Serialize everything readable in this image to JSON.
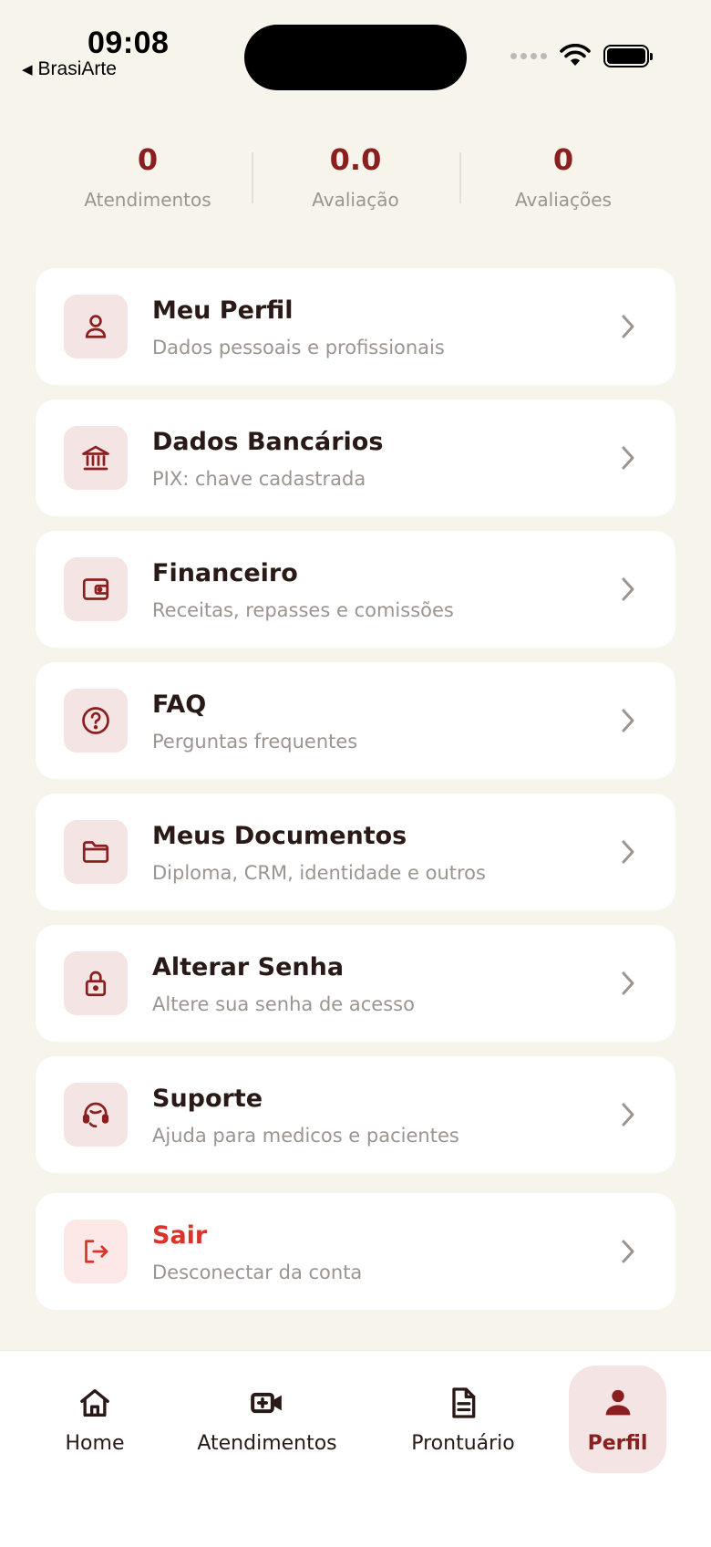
{
  "status_bar": {
    "time": "09:08",
    "back_app": "BrasiArte"
  },
  "stats": [
    {
      "value": "0",
      "label": "Atendimentos"
    },
    {
      "value": "0.0",
      "label": "Avaliação"
    },
    {
      "value": "0",
      "label": "Avaliações"
    }
  ],
  "menu": [
    {
      "title": "Meu Perfil",
      "subtitle": "Dados pessoais e profissionais",
      "icon": "user-icon"
    },
    {
      "title": "Dados Bancários",
      "subtitle": "PIX: chave cadastrada",
      "icon": "bank-icon"
    },
    {
      "title": "Financeiro",
      "subtitle": "Receitas, repasses e comissões",
      "icon": "wallet-icon"
    },
    {
      "title": "FAQ",
      "subtitle": "Perguntas frequentes",
      "icon": "help-circle-icon"
    },
    {
      "title": "Meus Documentos",
      "subtitle": "Diploma, CRM, identidade e outros",
      "icon": "folder-icon"
    },
    {
      "title": "Alterar Senha",
      "subtitle": "Altere sua senha de acesso",
      "icon": "lock-icon"
    },
    {
      "title": "Suporte",
      "subtitle": "Ajuda para medicos e pacientes",
      "icon": "headset-icon"
    }
  ],
  "logout": {
    "title": "Sair",
    "subtitle": "Desconectar da conta",
    "icon": "logout-icon"
  },
  "nav": [
    {
      "label": "Home",
      "icon": "home-icon",
      "active": false
    },
    {
      "label": "Atendimentos",
      "icon": "video-camera-icon",
      "active": false
    },
    {
      "label": "Prontuário",
      "icon": "document-icon",
      "active": false
    },
    {
      "label": "Perfil",
      "icon": "person-icon",
      "active": true
    }
  ],
  "colors": {
    "accent": "#8a1f1f",
    "danger": "#d9332a",
    "background": "#f7f4ec",
    "icon_bg": "#f4e4e3"
  }
}
